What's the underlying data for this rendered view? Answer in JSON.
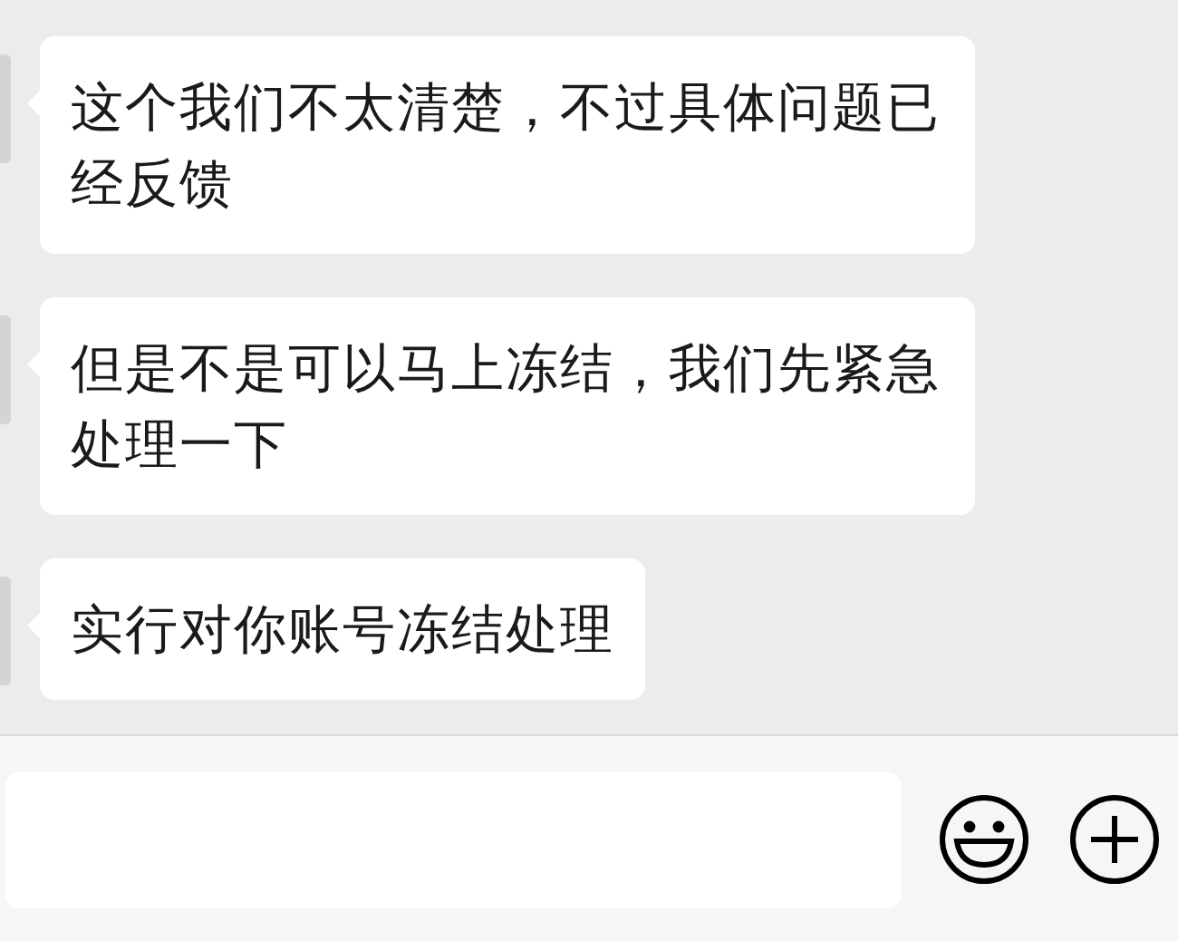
{
  "messages": [
    {
      "text": "这个我们不太清楚，不过具体问题已经反馈"
    },
    {
      "text": "但是不是可以马上冻结，我们先紧急处理一下"
    },
    {
      "text": "实行对你账号冻结处理"
    }
  ]
}
